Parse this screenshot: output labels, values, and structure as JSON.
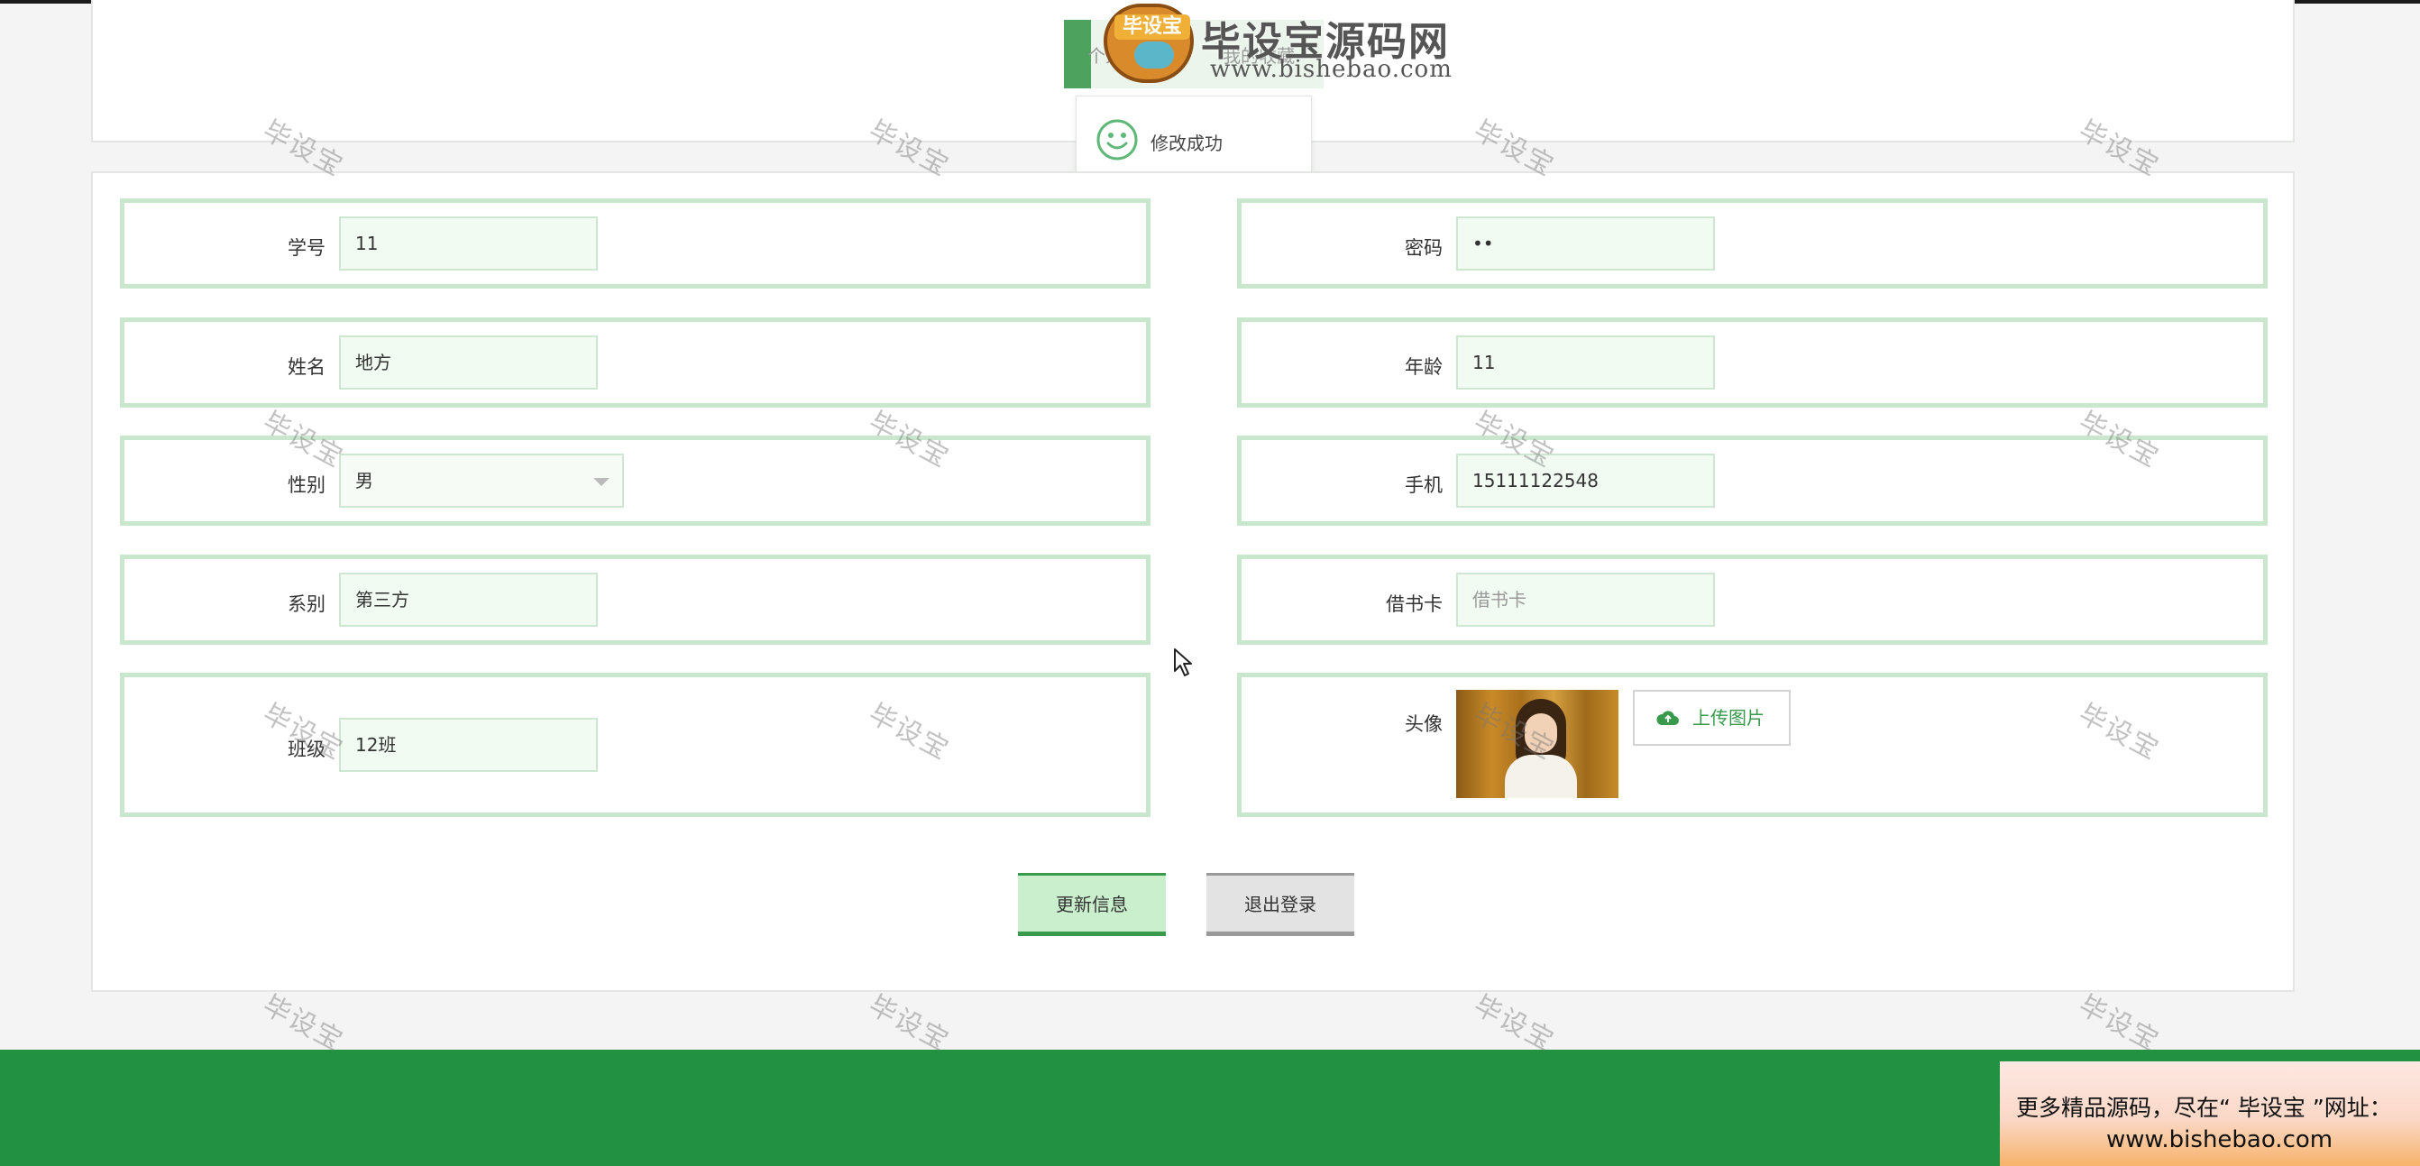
{
  "header": {
    "tab_left": "个人中心",
    "tab_right": "我的收藏"
  },
  "logo": {
    "mascot_label": "毕设宝",
    "title": "毕设宝源码网",
    "url": "www.bishebao.com"
  },
  "toast": {
    "icon": "smile-icon",
    "message": "修改成功"
  },
  "form": {
    "student_id": {
      "label": "学号",
      "value": "11"
    },
    "password": {
      "label": "密码",
      "value": "••"
    },
    "name": {
      "label": "姓名",
      "value": "地方"
    },
    "age": {
      "label": "年龄",
      "value": "11"
    },
    "gender": {
      "label": "性别",
      "value": "男"
    },
    "phone": {
      "label": "手机",
      "value": "15111122548"
    },
    "department": {
      "label": "系别",
      "value": "第三方"
    },
    "library_card": {
      "label": "借书卡",
      "value": "",
      "placeholder": "借书卡"
    },
    "class": {
      "label": "班级",
      "value": "12班"
    },
    "avatar": {
      "label": "头像",
      "upload_label": "上传图片",
      "upload_icon": "cloud-upload-icon"
    }
  },
  "actions": {
    "update_label": "更新信息",
    "logout_label": "退出登录"
  },
  "ad": {
    "line1": "更多精品源码，尽在“ 毕设宝 ”网址：",
    "line2": "www.bishebao.com"
  },
  "watermark": "毕设宝",
  "colors": {
    "accent": "#3a9a4c",
    "footer": "#239142",
    "field_border": "#c9e7cc",
    "input_bg": "#f1fbf2"
  }
}
